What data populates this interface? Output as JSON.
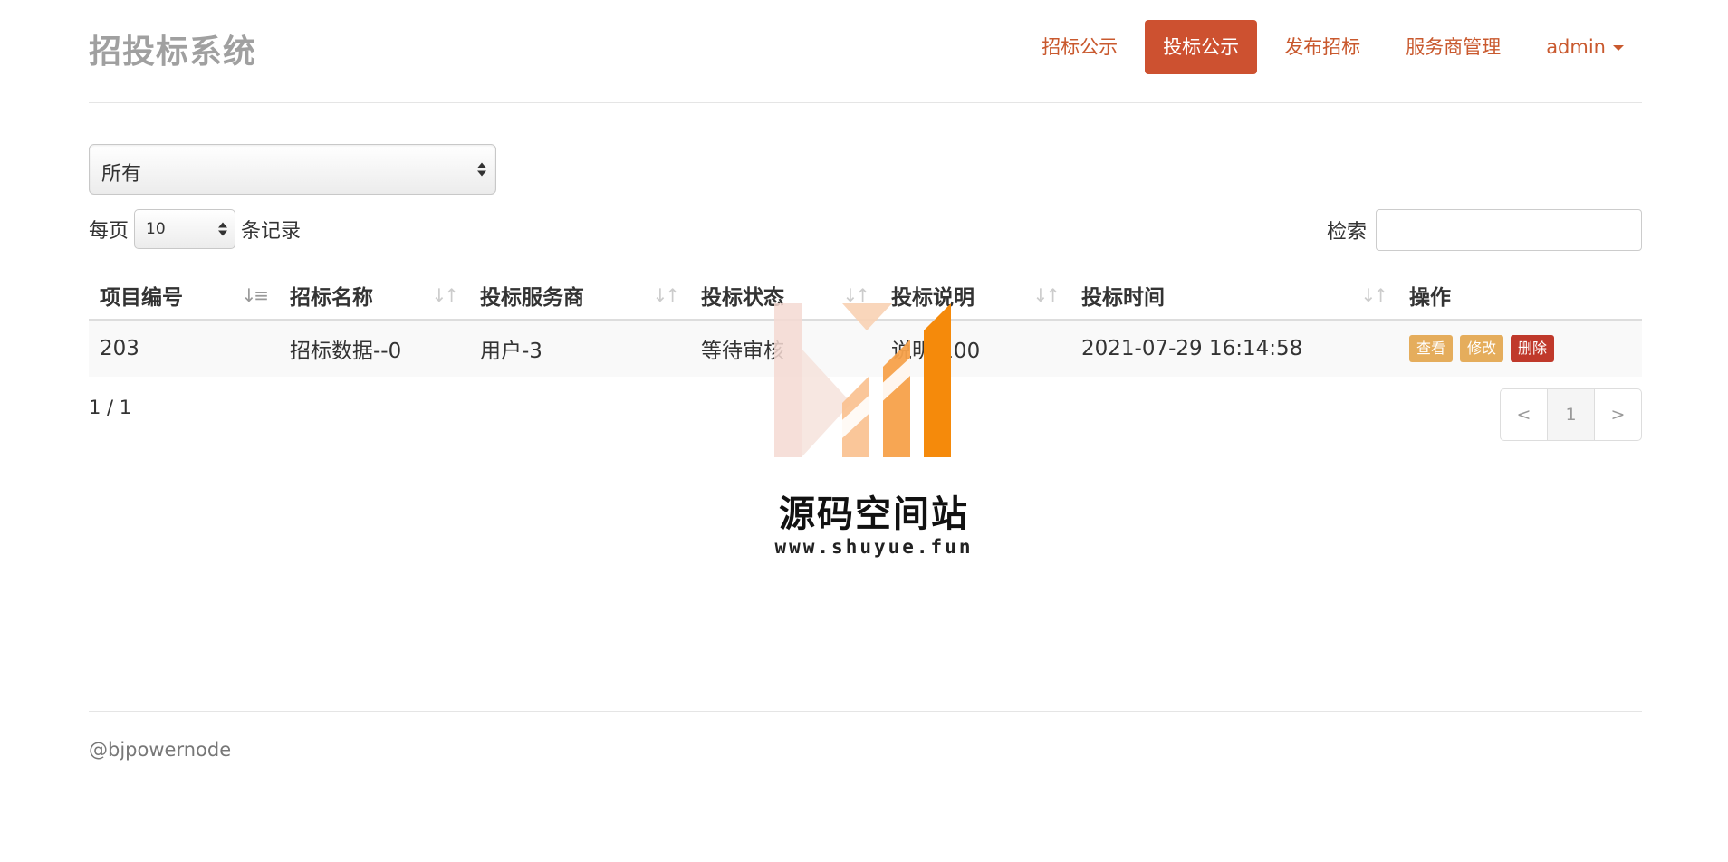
{
  "brand": "招投标系统",
  "nav": {
    "items": [
      "招标公示",
      "投标公示",
      "发布招标",
      "服务商管理"
    ],
    "active_index": 1,
    "user": "admin"
  },
  "filter": {
    "selected": "所有"
  },
  "length": {
    "prefix": "每页",
    "value": "10",
    "suffix": "条记录"
  },
  "search": {
    "label": "检索",
    "value": ""
  },
  "table": {
    "columns": [
      "项目编号",
      "招标名称",
      "投标服务商",
      "投标状态",
      "投标说明",
      "投标时间",
      "操作"
    ],
    "rows": [
      {
        "id": "203",
        "tender_name": "招标数据--0",
        "bidder": "用户-3",
        "status": "等待审核",
        "description": "说明-100",
        "time": "2021-07-29 16:14:58",
        "actions": [
          "查看",
          "修改",
          "删除"
        ]
      }
    ]
  },
  "info": "1 / 1",
  "pagination": {
    "prev": "<",
    "current": "1",
    "next": ">"
  },
  "footer": "@bjpowernode",
  "watermark": {
    "title": "源码空间站",
    "url": "www.shuyue.fun"
  },
  "colors": {
    "accent": "#cd5130",
    "nav_text": "#c9592e",
    "view_btn": "#e5ad5c",
    "delete_btn": "#c0392b"
  }
}
